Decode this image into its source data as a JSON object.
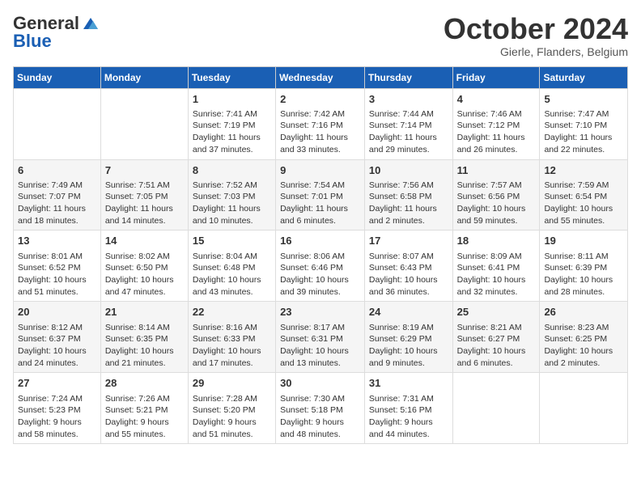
{
  "logo": {
    "general": "General",
    "blue": "Blue"
  },
  "title": "October 2024",
  "location": "Gierle, Flanders, Belgium",
  "days_header": [
    "Sunday",
    "Monday",
    "Tuesday",
    "Wednesday",
    "Thursday",
    "Friday",
    "Saturday"
  ],
  "weeks": [
    [
      {
        "day": "",
        "info": ""
      },
      {
        "day": "",
        "info": ""
      },
      {
        "day": "1",
        "info": "Sunrise: 7:41 AM\nSunset: 7:19 PM\nDaylight: 11 hours and 37 minutes."
      },
      {
        "day": "2",
        "info": "Sunrise: 7:42 AM\nSunset: 7:16 PM\nDaylight: 11 hours and 33 minutes."
      },
      {
        "day": "3",
        "info": "Sunrise: 7:44 AM\nSunset: 7:14 PM\nDaylight: 11 hours and 29 minutes."
      },
      {
        "day": "4",
        "info": "Sunrise: 7:46 AM\nSunset: 7:12 PM\nDaylight: 11 hours and 26 minutes."
      },
      {
        "day": "5",
        "info": "Sunrise: 7:47 AM\nSunset: 7:10 PM\nDaylight: 11 hours and 22 minutes."
      }
    ],
    [
      {
        "day": "6",
        "info": "Sunrise: 7:49 AM\nSunset: 7:07 PM\nDaylight: 11 hours and 18 minutes."
      },
      {
        "day": "7",
        "info": "Sunrise: 7:51 AM\nSunset: 7:05 PM\nDaylight: 11 hours and 14 minutes."
      },
      {
        "day": "8",
        "info": "Sunrise: 7:52 AM\nSunset: 7:03 PM\nDaylight: 11 hours and 10 minutes."
      },
      {
        "day": "9",
        "info": "Sunrise: 7:54 AM\nSunset: 7:01 PM\nDaylight: 11 hours and 6 minutes."
      },
      {
        "day": "10",
        "info": "Sunrise: 7:56 AM\nSunset: 6:58 PM\nDaylight: 11 hours and 2 minutes."
      },
      {
        "day": "11",
        "info": "Sunrise: 7:57 AM\nSunset: 6:56 PM\nDaylight: 10 hours and 59 minutes."
      },
      {
        "day": "12",
        "info": "Sunrise: 7:59 AM\nSunset: 6:54 PM\nDaylight: 10 hours and 55 minutes."
      }
    ],
    [
      {
        "day": "13",
        "info": "Sunrise: 8:01 AM\nSunset: 6:52 PM\nDaylight: 10 hours and 51 minutes."
      },
      {
        "day": "14",
        "info": "Sunrise: 8:02 AM\nSunset: 6:50 PM\nDaylight: 10 hours and 47 minutes."
      },
      {
        "day": "15",
        "info": "Sunrise: 8:04 AM\nSunset: 6:48 PM\nDaylight: 10 hours and 43 minutes."
      },
      {
        "day": "16",
        "info": "Sunrise: 8:06 AM\nSunset: 6:46 PM\nDaylight: 10 hours and 39 minutes."
      },
      {
        "day": "17",
        "info": "Sunrise: 8:07 AM\nSunset: 6:43 PM\nDaylight: 10 hours and 36 minutes."
      },
      {
        "day": "18",
        "info": "Sunrise: 8:09 AM\nSunset: 6:41 PM\nDaylight: 10 hours and 32 minutes."
      },
      {
        "day": "19",
        "info": "Sunrise: 8:11 AM\nSunset: 6:39 PM\nDaylight: 10 hours and 28 minutes."
      }
    ],
    [
      {
        "day": "20",
        "info": "Sunrise: 8:12 AM\nSunset: 6:37 PM\nDaylight: 10 hours and 24 minutes."
      },
      {
        "day": "21",
        "info": "Sunrise: 8:14 AM\nSunset: 6:35 PM\nDaylight: 10 hours and 21 minutes."
      },
      {
        "day": "22",
        "info": "Sunrise: 8:16 AM\nSunset: 6:33 PM\nDaylight: 10 hours and 17 minutes."
      },
      {
        "day": "23",
        "info": "Sunrise: 8:17 AM\nSunset: 6:31 PM\nDaylight: 10 hours and 13 minutes."
      },
      {
        "day": "24",
        "info": "Sunrise: 8:19 AM\nSunset: 6:29 PM\nDaylight: 10 hours and 9 minutes."
      },
      {
        "day": "25",
        "info": "Sunrise: 8:21 AM\nSunset: 6:27 PM\nDaylight: 10 hours and 6 minutes."
      },
      {
        "day": "26",
        "info": "Sunrise: 8:23 AM\nSunset: 6:25 PM\nDaylight: 10 hours and 2 minutes."
      }
    ],
    [
      {
        "day": "27",
        "info": "Sunrise: 7:24 AM\nSunset: 5:23 PM\nDaylight: 9 hours and 58 minutes."
      },
      {
        "day": "28",
        "info": "Sunrise: 7:26 AM\nSunset: 5:21 PM\nDaylight: 9 hours and 55 minutes."
      },
      {
        "day": "29",
        "info": "Sunrise: 7:28 AM\nSunset: 5:20 PM\nDaylight: 9 hours and 51 minutes."
      },
      {
        "day": "30",
        "info": "Sunrise: 7:30 AM\nSunset: 5:18 PM\nDaylight: 9 hours and 48 minutes."
      },
      {
        "day": "31",
        "info": "Sunrise: 7:31 AM\nSunset: 5:16 PM\nDaylight: 9 hours and 44 minutes."
      },
      {
        "day": "",
        "info": ""
      },
      {
        "day": "",
        "info": ""
      }
    ]
  ]
}
